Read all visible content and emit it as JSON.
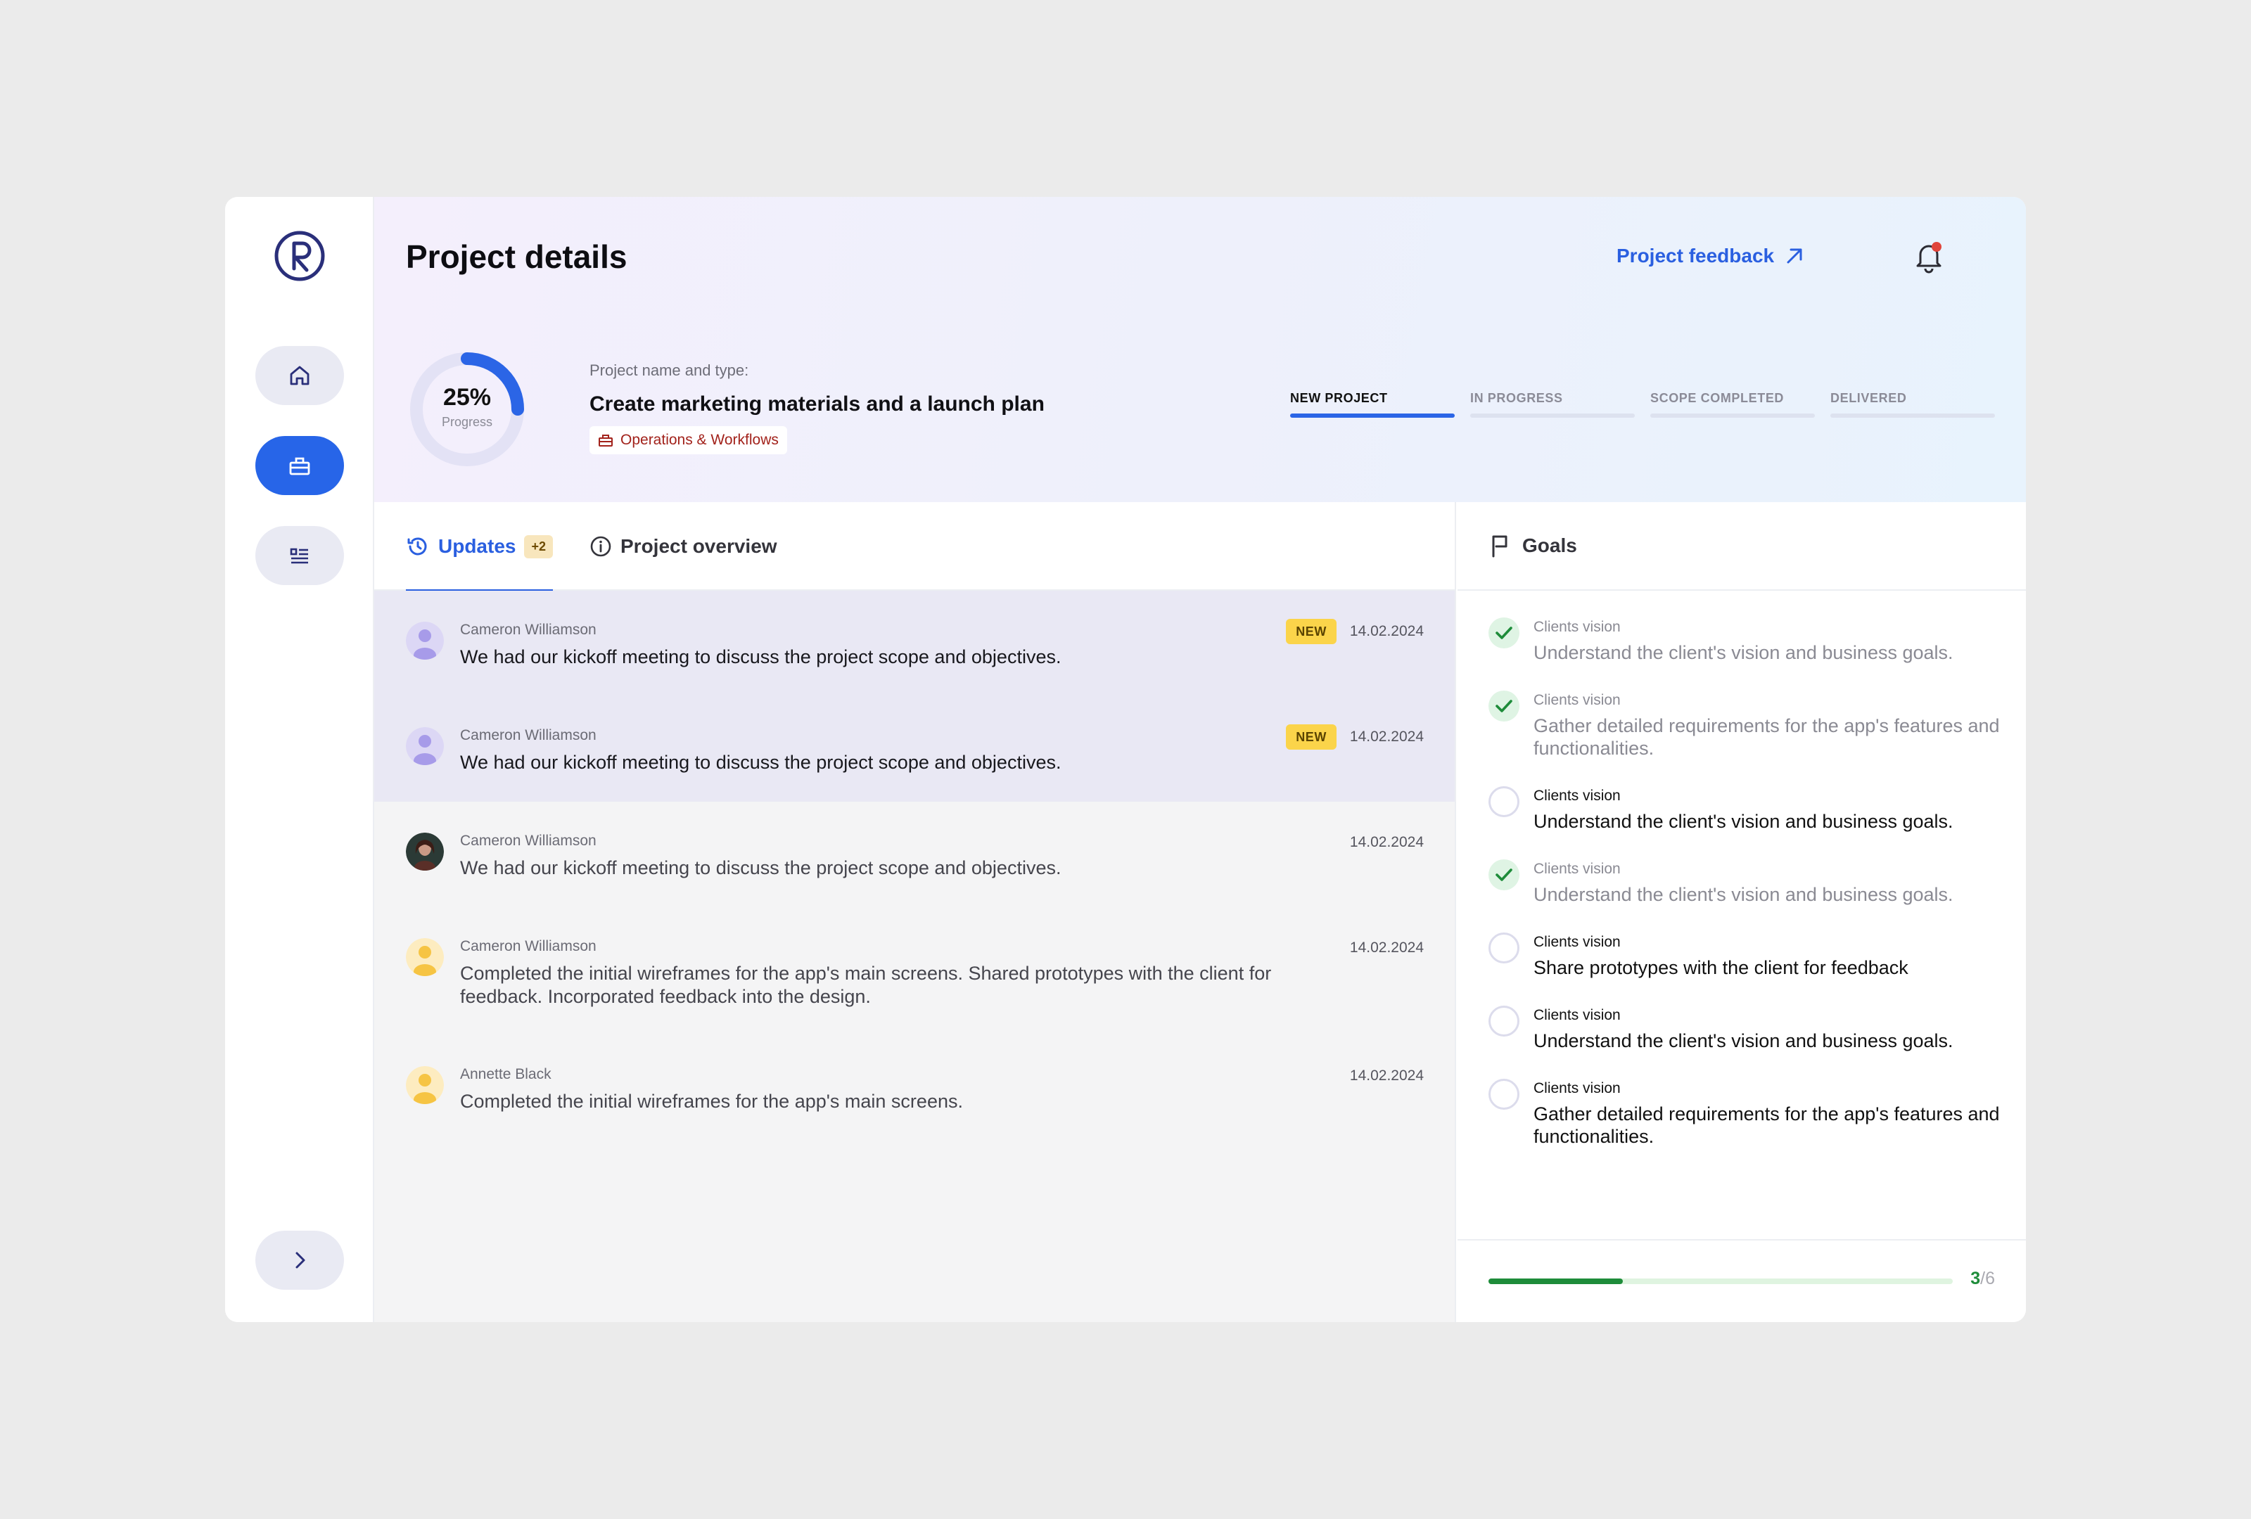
{
  "header": {
    "title": "Project details",
    "feedback_label": "Project feedback"
  },
  "project": {
    "progress_value": "25%",
    "progress_fraction": 0.25,
    "progress_label": "Progress",
    "caption": "Project name and type:",
    "name": "Create marketing materials and a launch plan",
    "tag": "Operations & Workflows"
  },
  "stages": [
    {
      "label": "NEW PROJECT",
      "active": true
    },
    {
      "label": "IN PROGRESS",
      "active": false
    },
    {
      "label": "SCOPE COMPLETED",
      "active": false
    },
    {
      "label": "DELIVERED",
      "active": false
    }
  ],
  "tabs": {
    "updates": "Updates",
    "updates_badge": "+2",
    "overview": "Project overview"
  },
  "updates": [
    {
      "author": "Cameron Williamson",
      "text": "We had our kickoff meeting to discuss the project scope and objectives.",
      "date": "14.02.2024",
      "badge": "NEW"
    },
    {
      "author": "Cameron Williamson",
      "text": "We had our kickoff meeting to discuss the project scope and objectives.",
      "date": "14.02.2024",
      "badge": "NEW"
    },
    {
      "author": "Cameron Williamson",
      "text": "We had our kickoff meeting to discuss the project scope and objectives.",
      "date": "14.02.2024"
    },
    {
      "author": "Cameron Williamson",
      "text": "Completed the initial wireframes for the app's main screens. Shared prototypes with the client for feedback. Incorporated feedback into the design.",
      "date": "14.02.2024"
    },
    {
      "author": "Annette Black",
      "text": "Completed the initial wireframes for the app's main screens.",
      "date": "14.02.2024"
    }
  ],
  "goals": {
    "title": "Goals",
    "items": [
      {
        "title": "Clients vision",
        "text": "Understand the client's vision and business goals.",
        "done": true
      },
      {
        "title": "Clients vision",
        "text": "Gather detailed requirements for the app's features and functionalities.",
        "done": true
      },
      {
        "title": "Clients vision",
        "text": "Understand the client's vision and business goals.",
        "done": false
      },
      {
        "title": "Clients vision",
        "text": "Understand the client's vision and business goals.",
        "done": true
      },
      {
        "title": "Clients vision",
        "text": "Share prototypes with the client for feedback",
        "done": false
      },
      {
        "title": "Clients vision",
        "text": "Understand the client's vision and business goals.",
        "done": false
      },
      {
        "title": "Clients vision",
        "text": "Gather detailed requirements for the app's features and functionalities.",
        "done": false
      }
    ],
    "done_count": "3",
    "total_label": "/6",
    "progress_fraction": 0.29
  },
  "colors": {
    "accent": "#2a5fe0",
    "success": "#1e8c3a",
    "badge_new": "#fbd44a",
    "tag_text": "#a2221b"
  }
}
